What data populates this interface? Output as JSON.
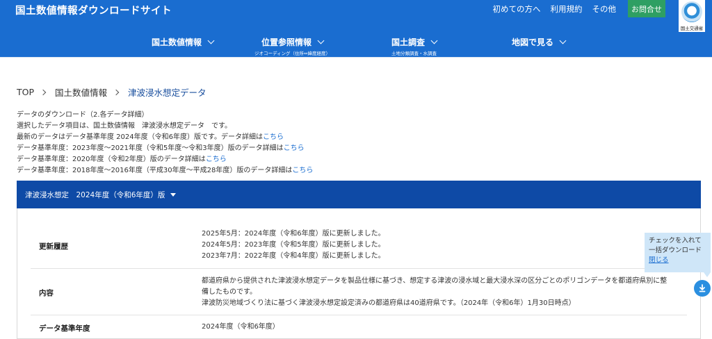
{
  "header": {
    "site_title": "国土数値情報ダウンロードサイト",
    "links": [
      "初めての方へ",
      "利用規約",
      "その他"
    ],
    "contact_label": "お問合せ",
    "logo_caption": "国土交通省"
  },
  "nav": [
    {
      "label": "国土数値情報",
      "sub": ""
    },
    {
      "label": "位置参照情報",
      "sub": "ジオコーディング（住所⇔緯度経度）"
    },
    {
      "label": "国土調査",
      "sub": "土地分類調査・水調査"
    },
    {
      "label": "地図で見る",
      "sub": ""
    }
  ],
  "breadcrumb": [
    "TOP",
    "国土数値情報",
    "津波浸水想定データ"
  ],
  "intro": {
    "line1": "データのダウンロード（2.各データ詳細）",
    "line2": "選択したデータ項目は、国土数値情報　津波浸水想定データ　です。",
    "line3": "最新のデータはデータ基準年度 2024年度（令和6年度）版です。データ詳細は",
    "line4": "データ基準年度：2023年度〜2021年度（令和5年度〜令和3年度）版のデータ詳細は",
    "line5": "データ基準年度：2020年度（令和2年度）版のデータ詳細は",
    "line6": "データ基準年度：2018年度〜2016年度（平成30年度〜平成28年度）版のデータ詳細は",
    "link_label": "こちら"
  },
  "panel": {
    "title": "津波浸水想定　2024年度（令和6年度）版",
    "rows": [
      {
        "label": "更新履歴",
        "lines": [
          "2025年5月：2024年度（令和6年度）版に更新しました。",
          "2024年5月：2023年度（令和5年度）版に更新しました。",
          "2023年7月：2022年度（令和4年度）版に更新しました。"
        ]
      },
      {
        "label": "内容",
        "lines": [
          "都道府県から提供された津波浸水想定データを製品仕様に基づき、想定する津波の浸水域と最大浸水深の区分ごとのポリゴンデータを都道府県別に整",
          "備したものです。",
          "津波防災地域づくり法に基づく津波浸水想定設定済みの都道府県は40道府県です。（2024年（令和6年）1月30日時点）"
        ]
      },
      {
        "label": "データ基準年度",
        "lines": [
          "2024年度（令和6年度）"
        ]
      }
    ]
  },
  "float": {
    "line1": "チェックを入れて",
    "line2": "一括ダウンロード",
    "close_label": "閉じる"
  }
}
